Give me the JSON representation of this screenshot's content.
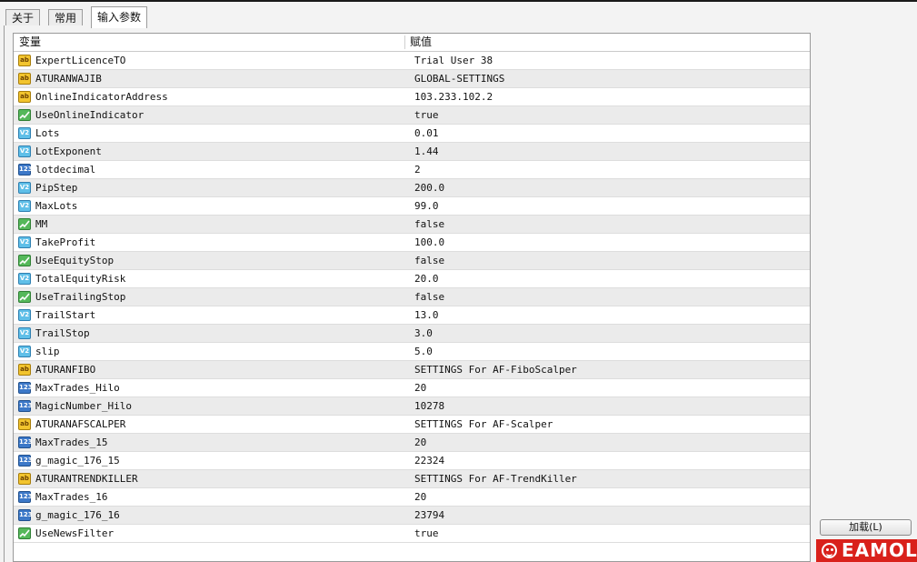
{
  "tabs": [
    {
      "label": "关于"
    },
    {
      "label": "常用"
    },
    {
      "label": "输入参数"
    }
  ],
  "table": {
    "headers": [
      "变量",
      "赋值"
    ],
    "rows": [
      {
        "type": "string",
        "icon": "ab",
        "name": "ExpertLicenceTO",
        "value": "Trial User 38"
      },
      {
        "type": "string",
        "icon": "ab",
        "name": "ATURANWAJIB",
        "value": "GLOBAL-SETTINGS"
      },
      {
        "type": "string",
        "icon": "ab",
        "name": "OnlineIndicatorAddress",
        "value": "103.233.102.2"
      },
      {
        "type": "bool",
        "icon": "",
        "name": "UseOnlineIndicator",
        "value": "true"
      },
      {
        "type": "double",
        "icon": "V2",
        "name": "Lots",
        "value": "0.01"
      },
      {
        "type": "double",
        "icon": "V2",
        "name": "LotExponent",
        "value": "1.44"
      },
      {
        "type": "int",
        "icon": "123",
        "name": "lotdecimal",
        "value": "2"
      },
      {
        "type": "double",
        "icon": "V2",
        "name": "PipStep",
        "value": "200.0"
      },
      {
        "type": "double",
        "icon": "V2",
        "name": "MaxLots",
        "value": "99.0"
      },
      {
        "type": "bool",
        "icon": "",
        "name": "MM",
        "value": "false"
      },
      {
        "type": "double",
        "icon": "V2",
        "name": "TakeProfit",
        "value": "100.0"
      },
      {
        "type": "bool",
        "icon": "",
        "name": "UseEquityStop",
        "value": "false"
      },
      {
        "type": "double",
        "icon": "V2",
        "name": "TotalEquityRisk",
        "value": "20.0"
      },
      {
        "type": "bool",
        "icon": "",
        "name": "UseTrailingStop",
        "value": "false"
      },
      {
        "type": "double",
        "icon": "V2",
        "name": "TrailStart",
        "value": "13.0"
      },
      {
        "type": "double",
        "icon": "V2",
        "name": "TrailStop",
        "value": "3.0"
      },
      {
        "type": "double",
        "icon": "V2",
        "name": "slip",
        "value": "5.0"
      },
      {
        "type": "string",
        "icon": "ab",
        "name": "ATURANFIBO",
        "value": "SETTINGS For AF-FiboScalper"
      },
      {
        "type": "int",
        "icon": "123",
        "name": "MaxTrades_Hilo",
        "value": "20"
      },
      {
        "type": "int",
        "icon": "123",
        "name": "MagicNumber_Hilo",
        "value": "10278"
      },
      {
        "type": "string",
        "icon": "ab",
        "name": "ATURANAFSCALPER",
        "value": "SETTINGS For AF-Scalper"
      },
      {
        "type": "int",
        "icon": "123",
        "name": "MaxTrades_15",
        "value": "20"
      },
      {
        "type": "int",
        "icon": "123",
        "name": "g_magic_176_15",
        "value": "22324"
      },
      {
        "type": "string",
        "icon": "ab",
        "name": "ATURANTRENDKILLER",
        "value": "SETTINGS For AF-TrendKiller"
      },
      {
        "type": "int",
        "icon": "123",
        "name": "MaxTrades_16",
        "value": "20"
      },
      {
        "type": "int",
        "icon": "123",
        "name": "g_magic_176_16",
        "value": "23794"
      },
      {
        "type": "bool",
        "icon": "",
        "name": "UseNewsFilter",
        "value": "true"
      }
    ]
  },
  "load_button": {
    "label": "加载(L)"
  },
  "logo": {
    "text": "EAMOL",
    "color": "#d9211b"
  },
  "colors": {
    "row_alt": "#ebebeb",
    "string_icon": "#f2c42e",
    "double_icon": "#5fbfe8",
    "int_icon": "#3c78c8",
    "bool_icon": "#55b85a"
  }
}
